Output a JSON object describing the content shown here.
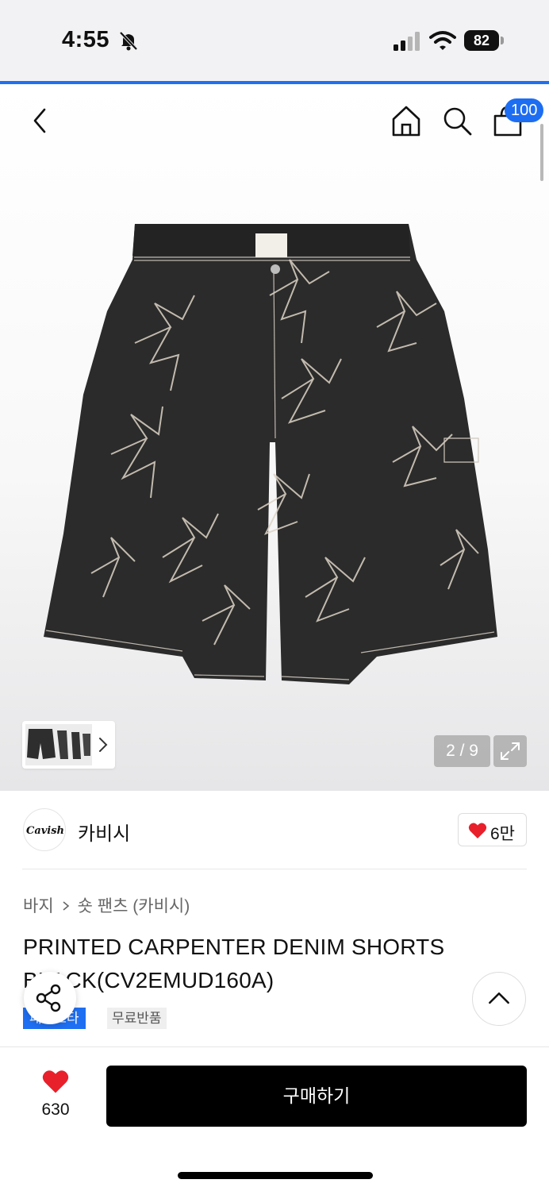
{
  "status_bar": {
    "time": "4:55",
    "battery": "82"
  },
  "nav": {
    "cart_count": "100"
  },
  "gallery": {
    "counter": "2 / 9"
  },
  "brand": {
    "name": "카비시",
    "logo_text": "Cavish",
    "likes": "6만"
  },
  "product": {
    "breadcrumb": [
      "바지",
      "숏 팬츠 (카비시)"
    ],
    "title": "PRINTED CARPENTER DENIM SHORTS BLACK(CV2EMUD160A)",
    "tags": [
      "패션스타",
      "무료반품"
    ]
  },
  "bottom_bar": {
    "wish_count": "630",
    "buy_label": "구매하기"
  },
  "colors": {
    "accent": "#1f6ff2",
    "heart": "#e8202b",
    "button": "#000000"
  }
}
